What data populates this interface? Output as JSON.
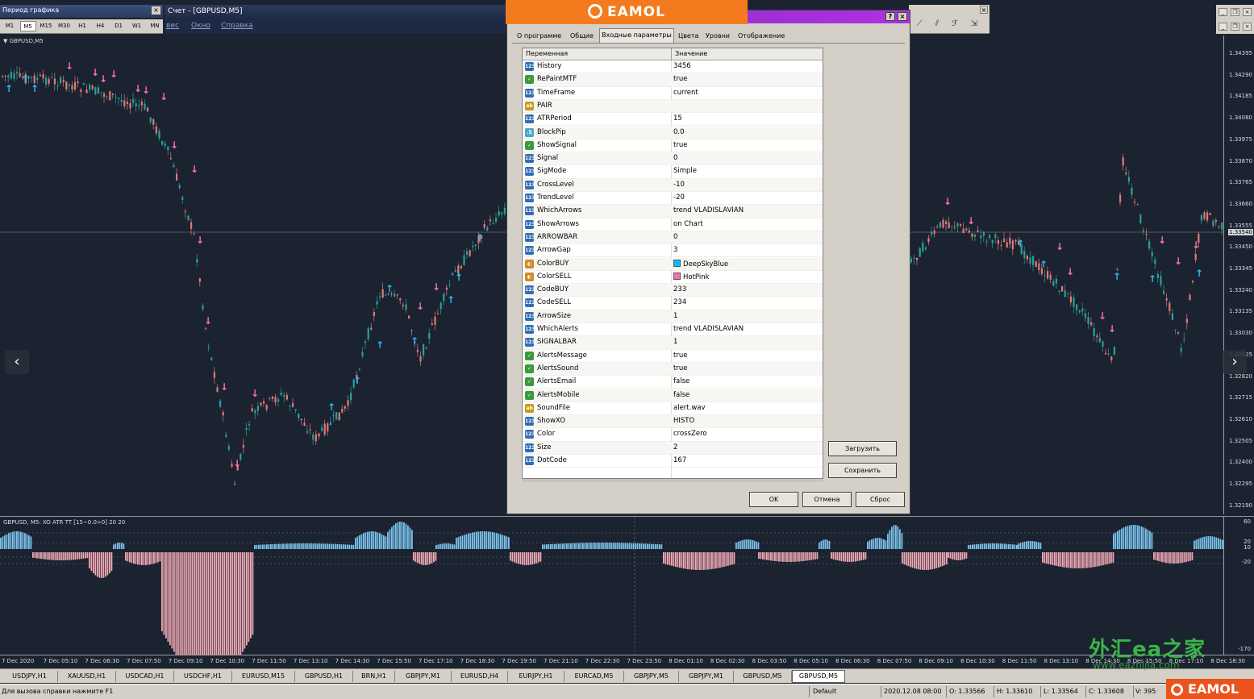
{
  "left_panel": {
    "title": "Период графика",
    "close": "×"
  },
  "timeframes": [
    "M1",
    "M5",
    "M15",
    "M30",
    "H1",
    "H4",
    "D1",
    "W1",
    "MN"
  ],
  "timeframe_active": "M5",
  "account_window": {
    "title": "Счет - [GBPUSD,M5]"
  },
  "menu": [
    "вис",
    "Окно",
    "Справка"
  ],
  "chart": {
    "symbol_label": "▼ GBPUSD,M5",
    "price_levels": [
      "1.34395",
      "1.34290",
      "1.34185",
      "1.34080",
      "1.33975",
      "1.33870",
      "1.33765",
      "1.33660",
      "1.33555",
      "1.33450",
      "1.33345",
      "1.33240",
      "1.33135",
      "1.33030",
      "1.32925",
      "1.32820",
      "1.32715",
      "1.32610",
      "1.32505",
      "1.32400",
      "1.32295",
      "1.32190"
    ],
    "current_price": "1.33540",
    "colors": {
      "buy": "#28b9f0",
      "sell": "#ff6fb0",
      "candle_up": "#2aa198",
      "candle_down": "#e07a7a",
      "background": "#1b2330"
    }
  },
  "indicator": {
    "title": "GBPUSD, M5: XO ATR TT [15~0.0>0]  20 20",
    "axis_labels": [
      "60",
      "20",
      "10",
      "-20",
      "-170"
    ],
    "colors": {
      "positive": "#7cc3ee",
      "negative": "#f0a9b4"
    }
  },
  "time_axis": [
    "7 Dec 2020",
    "7 Dec 05:10",
    "7 Dec 06:30",
    "7 Dec 07:50",
    "7 Dec 09:10",
    "7 Dec 10:30",
    "7 Dec 11:50",
    "7 Dec 13:10",
    "7 Dec 14:30",
    "7 Dec 15:50",
    "7 Dec 17:10",
    "7 Dec 18:30",
    "7 Dec 19:50",
    "7 Dec 21:10",
    "7 Dec 22:30",
    "7 Dec 23:50",
    "8 Dec 01:10",
    "8 Dec 02:30",
    "8 Dec 03:50",
    "8 Dec 05:10",
    "8 Dec 06:30",
    "8 Dec 07:50",
    "8 Dec 09:10",
    "8 Dec 10:30",
    "8 Dec 11:50",
    "8 Dec 13:10",
    "8 Dec 14:30",
    "8 Dec 15:50",
    "8 Dec 17:10",
    "8 Dec 18:30"
  ],
  "banner": {
    "brand": "EAMOL"
  },
  "dialog": {
    "help": "?",
    "close": "×",
    "tabs": [
      "О программе",
      "Общие",
      "Входные параметры",
      "Цвета",
      "Уровни",
      "Отображение"
    ],
    "active_tab": "Входные параметры",
    "columns": {
      "variable": "Переменная",
      "value": "Значение"
    },
    "params": [
      {
        "name": "History",
        "value": "3456",
        "type": "int"
      },
      {
        "name": "RePaintMTF",
        "value": "true",
        "type": "bool"
      },
      {
        "name": "TimeFrame",
        "value": "current",
        "type": "int"
      },
      {
        "name": "PAIR",
        "value": "",
        "type": "str"
      },
      {
        "name": "ATRPeriod",
        "value": "15",
        "type": "int"
      },
      {
        "name": "BlockPip",
        "value": "0.0",
        "type": "dbl"
      },
      {
        "name": "ShowSignal",
        "value": "true",
        "type": "bool"
      },
      {
        "name": "Signal",
        "value": "0",
        "type": "int"
      },
      {
        "name": "SigMode",
        "value": "Simple",
        "type": "int"
      },
      {
        "name": "CrossLevel",
        "value": "-10",
        "type": "int"
      },
      {
        "name": "TrendLevel",
        "value": "-20",
        "type": "int"
      },
      {
        "name": "WhichArrows",
        "value": "trend VLADISLAVIAN",
        "type": "int"
      },
      {
        "name": "ShowArrows",
        "value": "on Chart",
        "type": "int"
      },
      {
        "name": "ARROWBAR",
        "value": "0",
        "type": "int"
      },
      {
        "name": "ArrowGap",
        "value": "3",
        "type": "int"
      },
      {
        "name": "ColorBUY",
        "value": "DeepSkyBlue",
        "type": "color",
        "swatch": "#00bfff"
      },
      {
        "name": "ColorSELL",
        "value": "HotPink",
        "type": "color",
        "swatch": "#ff69b4"
      },
      {
        "name": "CodeBUY",
        "value": "233",
        "type": "int"
      },
      {
        "name": "CodeSELL",
        "value": "234",
        "type": "int"
      },
      {
        "name": "ArrowSize",
        "value": "1",
        "type": "int"
      },
      {
        "name": "WhichAlerts",
        "value": "trend VLADISLAVIAN",
        "type": "int"
      },
      {
        "name": "SIGNALBAR",
        "value": "1",
        "type": "int"
      },
      {
        "name": "AlertsMessage",
        "value": "true",
        "type": "bool"
      },
      {
        "name": "AlertsSound",
        "value": "true",
        "type": "bool"
      },
      {
        "name": "AlertsEmail",
        "value": "false",
        "type": "bool"
      },
      {
        "name": "AlertsMobile",
        "value": "false",
        "type": "bool"
      },
      {
        "name": "SoundFile",
        "value": "alert.wav",
        "type": "str"
      },
      {
        "name": "ShowXO",
        "value": "HISTO",
        "type": "int"
      },
      {
        "name": "Color",
        "value": "crossZero",
        "type": "int"
      },
      {
        "name": "Size",
        "value": "2",
        "type": "int"
      },
      {
        "name": "DotCode",
        "value": "167",
        "type": "int"
      }
    ],
    "load_button": "Загрузить",
    "save_button": "Сохранить",
    "ok_button": "OK",
    "cancel_button": "Отмена",
    "reset_button": "Сброс"
  },
  "symbol_tabs": [
    "USDJPY,H1",
    "XAUUSD,H1",
    "USDCAD,H1",
    "USDCHF,H1",
    "EURUSD,M15",
    "GBPUSD,H1",
    "BRN,H1",
    "GBPJPY,M1",
    "EURUSD,H4",
    "EURJPY,H1",
    "EURCAD,M5",
    "GBPJPY,M5",
    "GBPJPY,M1",
    "GBPUSD,M5",
    "GBPUSD,M5"
  ],
  "symbol_tab_active": 14,
  "status": {
    "help": "Для вызова справки нажмите F1",
    "profile": "Default",
    "datetime": "2020.12.08 08:00",
    "open": "O: 1.33566",
    "high": "H: 1.33610",
    "low": "L: 1.33564",
    "close": "C: 1.33608",
    "volume": "V: 395"
  },
  "watermark": {
    "text": "外汇ea之家",
    "url": "www.eazhijia.com"
  }
}
